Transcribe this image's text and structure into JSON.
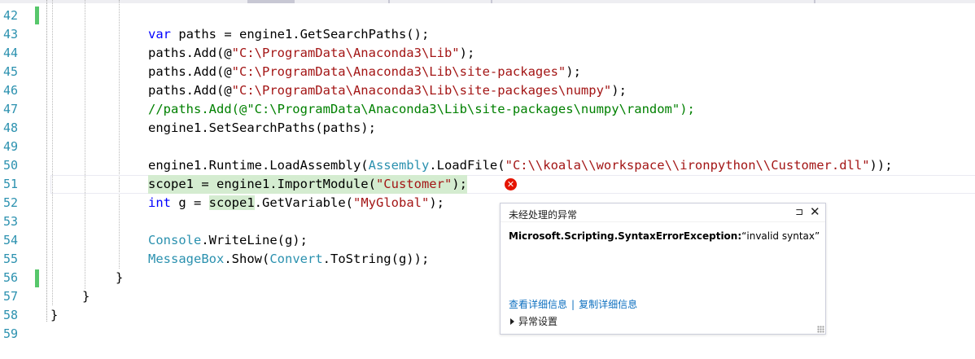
{
  "editor": {
    "line_numbers": [
      "42",
      "43",
      "44",
      "45",
      "46",
      "47",
      "48",
      "49",
      "50",
      "51",
      "52",
      "53",
      "54",
      "55",
      "56",
      "57",
      "58",
      "59"
    ],
    "lines": {
      "l43": {
        "kw": "var",
        "rest": " paths = engine1.GetSearchPaths();"
      },
      "l44": {
        "pre": "paths.Add(@",
        "str": "\"C:\\ProgramData\\Anaconda3\\Lib\"",
        "post": ");"
      },
      "l45": {
        "pre": "paths.Add(@",
        "str": "\"C:\\ProgramData\\Anaconda3\\Lib\\site-packages\"",
        "post": ");"
      },
      "l46": {
        "pre": "paths.Add(@",
        "str": "\"C:\\ProgramData\\Anaconda3\\Lib\\site-packages\\numpy\"",
        "post": ");"
      },
      "l47": {
        "cmt": "//paths.Add(@\"C:\\ProgramData\\Anaconda3\\Lib\\site-packages\\numpy\\random\");"
      },
      "l48": {
        "text": "engine1.SetSearchPaths(paths);"
      },
      "l50": {
        "pre": "engine1.Runtime.LoadAssembly(",
        "type": "Assembly",
        "mid": ".LoadFile(",
        "str": "\"C:\\\\koala\\\\workspace\\\\ironpython\\\\Customer.dll\"",
        "post": "));"
      },
      "l51": {
        "pre": "scope1 = engine1.ImportModule(",
        "str": "\"Customer\"",
        "post": ");"
      },
      "l52": {
        "kw": "int",
        "mid": " g = ",
        "hl": "scope1",
        "mid2": ".GetVariable(",
        "str": "\"MyGlobal\"",
        "post": ");"
      },
      "l54": {
        "type": "Console",
        "rest": ".WriteLine(g);"
      },
      "l55": {
        "type": "MessageBox",
        "mid": ".Show(",
        "type2": "Convert",
        "rest": ".ToString(g));"
      },
      "l56": {
        "text": "}"
      },
      "l57": {
        "text": "}"
      },
      "l58": {
        "text": "}"
      }
    }
  },
  "exception_popup": {
    "title": "未经处理的异常",
    "exception_name": "Microsoft.Scripting.SyntaxErrorException:",
    "exception_message": "“invalid syntax”",
    "link_view_details": "查看详细信息",
    "separator": "|",
    "link_copy_details": "复制详细信息",
    "settings_label": "异常设置",
    "pin_glyph": "⊐",
    "close_glyph": "✕",
    "error_glyph": "✕"
  },
  "colors": {
    "keyword": "#0000ff",
    "type": "#2b91af",
    "string": "#a31515",
    "comment": "#008000",
    "line_number": "#2b91af",
    "change_bar": "#57c76b",
    "error": "#e51400",
    "link": "#0e70c0"
  },
  "icons": [
    "error-circle-icon",
    "pin-icon",
    "close-icon",
    "expand-triangle-icon"
  ]
}
